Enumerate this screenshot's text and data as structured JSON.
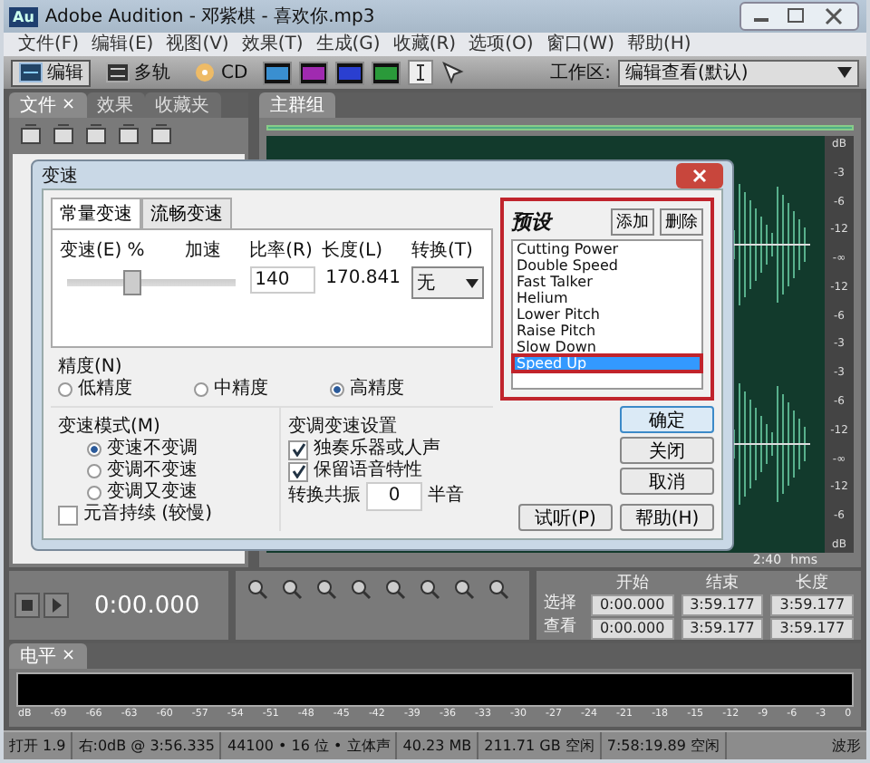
{
  "window": {
    "app_icon": "Au",
    "title": "Adobe Audition - 邓紫棋 - 喜欢你.mp3"
  },
  "menu": [
    "文件(F)",
    "编辑(E)",
    "视图(V)",
    "效果(T)",
    "生成(G)",
    "收藏(R)",
    "选项(O)",
    "窗口(W)",
    "帮助(H)"
  ],
  "toolbar": {
    "modes": [
      {
        "label": "编辑",
        "selected": true
      },
      {
        "label": "多轨",
        "selected": false
      },
      {
        "label": "CD",
        "selected": false
      }
    ],
    "workspace_label": "工作区:",
    "workspace_value": "编辑查看(默认)"
  },
  "files_panel": {
    "tabs": [
      {
        "label": "文件",
        "selected": true,
        "close": "×"
      },
      {
        "label": "效果",
        "selected": false
      },
      {
        "label": "收藏夹",
        "selected": false
      }
    ]
  },
  "main_panel": {
    "tab": "主群组",
    "scale": [
      "dB",
      "-3",
      "-6",
      "-12",
      "-∞",
      "-12",
      "-6",
      "-3",
      "-3",
      "-6",
      "-12",
      "-∞",
      "-12",
      "-6",
      "dB"
    ],
    "time": "2:40",
    "time_unit": "hms"
  },
  "transport": {
    "time": "0:00.000"
  },
  "selection": {
    "columns": [
      "开始",
      "结束",
      "长度"
    ],
    "rows": [
      {
        "label": "选择",
        "values": [
          "0:00.000",
          "3:59.177",
          "3:59.177"
        ]
      },
      {
        "label": "查看",
        "values": [
          "0:00.000",
          "3:59.177",
          "3:59.177"
        ]
      }
    ]
  },
  "levels": {
    "tab": "电平",
    "close": "×",
    "scale": [
      "dB",
      "-69",
      "-66",
      "-63",
      "-60",
      "-57",
      "-54",
      "-51",
      "-48",
      "-45",
      "-42",
      "-39",
      "-36",
      "-33",
      "-30",
      "-27",
      "-24",
      "-21",
      "-18",
      "-15",
      "-12",
      "-9",
      "-6",
      "-3",
      "0"
    ]
  },
  "status_bar": [
    "打开 1.9",
    "右:0dB @ 3:56.335",
    "44100 • 16 位 • 立体声",
    "40.23 MB",
    "211.71 GB 空闲",
    "7:58:19.89 空闲",
    "波形"
  ],
  "dialog": {
    "title": "变速",
    "tabs": [
      {
        "label": "常量变速",
        "selected": true
      },
      {
        "label": "流畅变速",
        "selected": false
      }
    ],
    "speed_label": "变速(E) %",
    "slider_label": "加速",
    "slider": {
      "level": 0.38
    },
    "fields": [
      {
        "label": "比率(R)",
        "value": "140",
        "kind": "input"
      },
      {
        "label": "长度(L)",
        "value": "170.841",
        "kind": "readonly"
      },
      {
        "label": "转换(T)",
        "value": "无",
        "kind": "dropdown"
      }
    ],
    "precision": {
      "label": "精度(N)",
      "options": [
        {
          "label": "低精度",
          "selected": false
        },
        {
          "label": "中精度",
          "selected": false
        },
        {
          "label": "高精度",
          "selected": true
        }
      ]
    },
    "mode": {
      "label": "变速模式(M)",
      "options": [
        {
          "label": "变速不变调",
          "selected": true
        },
        {
          "label": "变调不变速",
          "selected": false
        },
        {
          "label": "变调又变速",
          "selected": false
        }
      ],
      "checkbox": {
        "label": "元音持续 (较慢)",
        "checked": false
      }
    },
    "pitch_settings": {
      "label": "变调变速设置",
      "checkboxes": [
        {
          "label": "独奏乐器或人声",
          "checked": true
        },
        {
          "label": "保留语音特性",
          "checked": true
        }
      ],
      "formant_label": "转换共振",
      "formant_value": "0",
      "formant_unit": "半音"
    },
    "presets": {
      "title": "预设",
      "annotated": true,
      "buttons": [
        "添加",
        "删除"
      ],
      "items": [
        {
          "label": "Cutting Power",
          "selected": false,
          "annotated": false
        },
        {
          "label": "Double Speed",
          "selected": false,
          "annotated": false
        },
        {
          "label": "Fast Talker",
          "selected": false,
          "annotated": false
        },
        {
          "label": "Helium",
          "selected": false,
          "annotated": false
        },
        {
          "label": "Lower Pitch",
          "selected": false,
          "annotated": false
        },
        {
          "label": "Raise Pitch",
          "selected": false,
          "annotated": false
        },
        {
          "label": "Slow Down",
          "selected": false,
          "annotated": false
        },
        {
          "label": "Speed Up",
          "selected": true,
          "annotated": true
        }
      ]
    },
    "buttons": [
      {
        "label": "确定",
        "kind": "side",
        "default": true
      },
      {
        "label": "关闭",
        "kind": "side",
        "default": false
      },
      {
        "label": "取消",
        "kind": "side",
        "default": false
      },
      {
        "label": "试听(P)",
        "kind": "bottom",
        "default": false
      },
      {
        "label": "帮助(H)",
        "kind": "bottom",
        "default": false
      }
    ]
  }
}
